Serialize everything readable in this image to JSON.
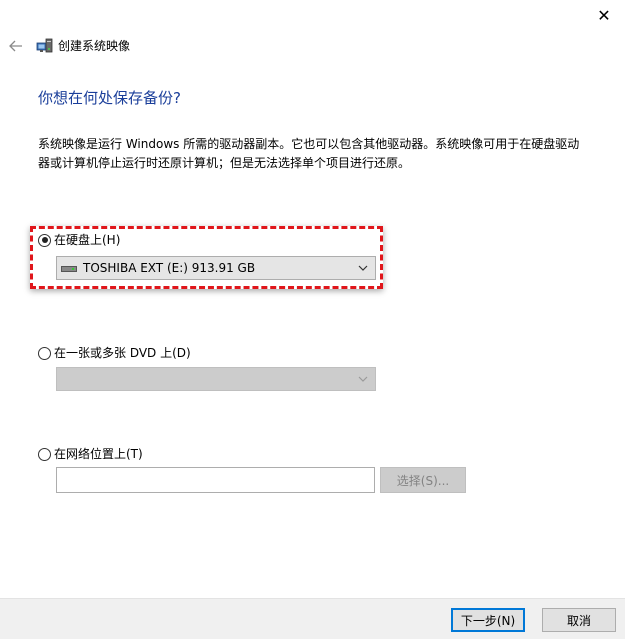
{
  "window": {
    "title": "创建系统映像",
    "close_glyph": "✕"
  },
  "page": {
    "heading": "你想在何处保存备份?",
    "description": "系统映像是运行 Windows 所需的驱动器副本。它也可以包含其他驱动器。系统映像可用于在硬盘驱动器或计算机停止运行时还原计算机；但是无法选择单个项目进行还原。"
  },
  "options": {
    "hard_disk": {
      "label": "在硬盘上(H)",
      "selected": true,
      "drive_value": "TOSHIBA EXT (E:)  913.91 GB"
    },
    "dvd": {
      "label": "在一张或多张 DVD 上(D)",
      "selected": false,
      "drive_value": ""
    },
    "network": {
      "label": "在网络位置上(T)",
      "selected": false,
      "path_value": "",
      "browse_label": "选择(S)..."
    }
  },
  "footer": {
    "next_label": "下一步(N)",
    "cancel_label": "取消"
  },
  "colors": {
    "heading": "#1a3e9a",
    "highlight": "#e0161b",
    "primary_border": "#0078d7"
  },
  "icons": {
    "back": "arrow-left-icon",
    "app": "system-image-icon",
    "drive": "hard-drive-icon",
    "dropdown": "chevron-down-icon",
    "close": "close-icon"
  }
}
